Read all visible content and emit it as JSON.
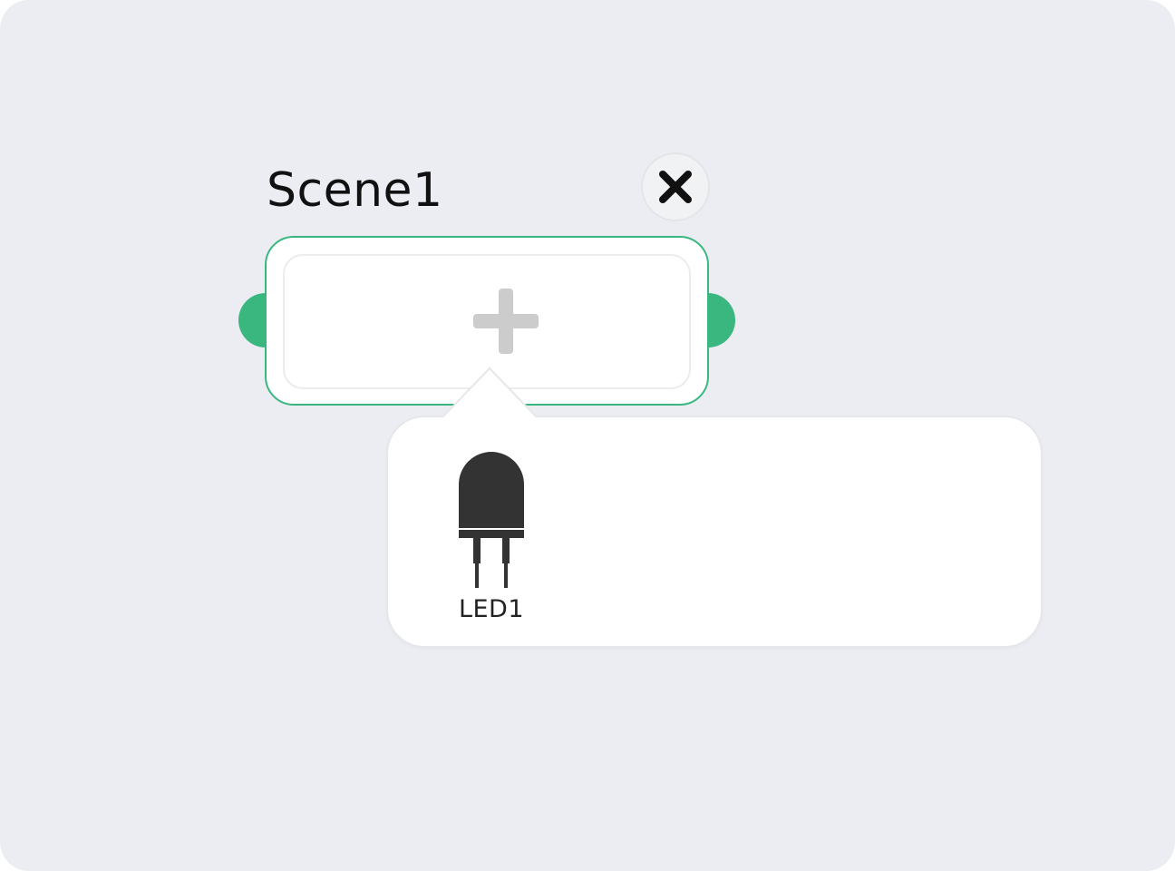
{
  "scene": {
    "title": "Scene1",
    "close_icon": "close-icon",
    "add_icon": "plus-icon"
  },
  "device_picker": {
    "items": [
      {
        "label": "LED1",
        "icon": "led-icon"
      }
    ]
  },
  "colors": {
    "background": "#ecedf2",
    "accent": "#3ab67f",
    "plus": "#cccccc",
    "icon_dark": "#333333"
  }
}
